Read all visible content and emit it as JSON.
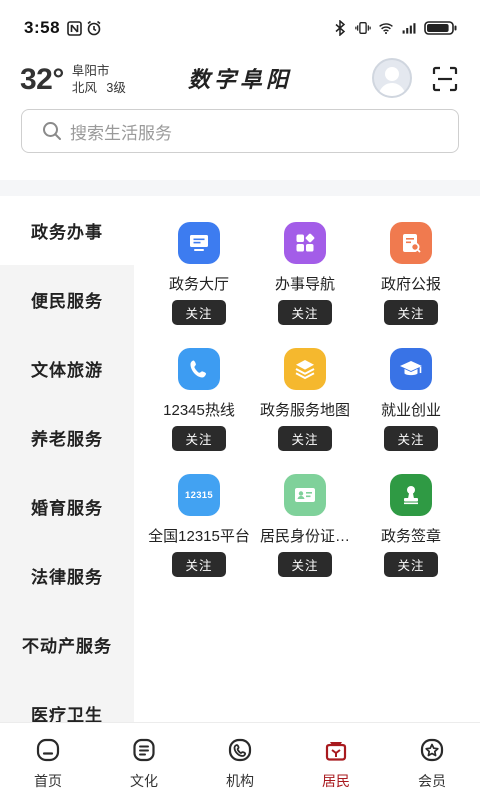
{
  "status_bar": {
    "time": "3:58",
    "battery_level": 0.9
  },
  "header": {
    "temperature": "32°",
    "city": "阜阳市",
    "wind": "北风",
    "wind_level": "3级",
    "app_title": "数字阜阳"
  },
  "search": {
    "placeholder": "搜索生活服务"
  },
  "sidebar": {
    "items": [
      {
        "label": "政务办事",
        "active": true
      },
      {
        "label": "便民服务",
        "active": false
      },
      {
        "label": "文体旅游",
        "active": false
      },
      {
        "label": "养老服务",
        "active": false
      },
      {
        "label": "婚育服务",
        "active": false
      },
      {
        "label": "法律服务",
        "active": false
      },
      {
        "label": "不动产服务",
        "active": false
      },
      {
        "label": "医疗卫生",
        "active": false
      }
    ]
  },
  "services": {
    "follow_label": "关注",
    "items": [
      {
        "label": "政务大厅",
        "icon": "monitor-icon",
        "color": "#3d7cf0"
      },
      {
        "label": "办事导航",
        "icon": "grid-apps-icon",
        "color": "#a35de8"
      },
      {
        "label": "政府公报",
        "icon": "document-search-icon",
        "color": "#f07a4f"
      },
      {
        "label": "12345热线",
        "icon": "phone-icon",
        "color": "#3d9cf2"
      },
      {
        "label": "政务服务地图",
        "icon": "layers-icon",
        "color": "#f5b82e"
      },
      {
        "label": "就业创业",
        "icon": "graduation-cap-icon",
        "color": "#3973e6"
      },
      {
        "label": "全国12315平台",
        "icon": "badge-12315-icon",
        "icon_text": "12315",
        "color": "#42a2f2"
      },
      {
        "label": "居民身份证…",
        "icon": "id-card-icon",
        "color": "#7fd19a"
      },
      {
        "label": "政务签章",
        "icon": "stamp-icon",
        "color": "#2f9a44"
      }
    ]
  },
  "tabbar": {
    "items": [
      {
        "label": "首页",
        "icon": "home-icon",
        "active": false
      },
      {
        "label": "文化",
        "icon": "document-icon",
        "active": false
      },
      {
        "label": "机构",
        "icon": "phone-circle-icon",
        "active": false
      },
      {
        "label": "居民",
        "icon": "resident-icon",
        "active": true
      },
      {
        "label": "会员",
        "icon": "member-star-icon",
        "active": false
      }
    ],
    "active_color": "#a8191e"
  }
}
